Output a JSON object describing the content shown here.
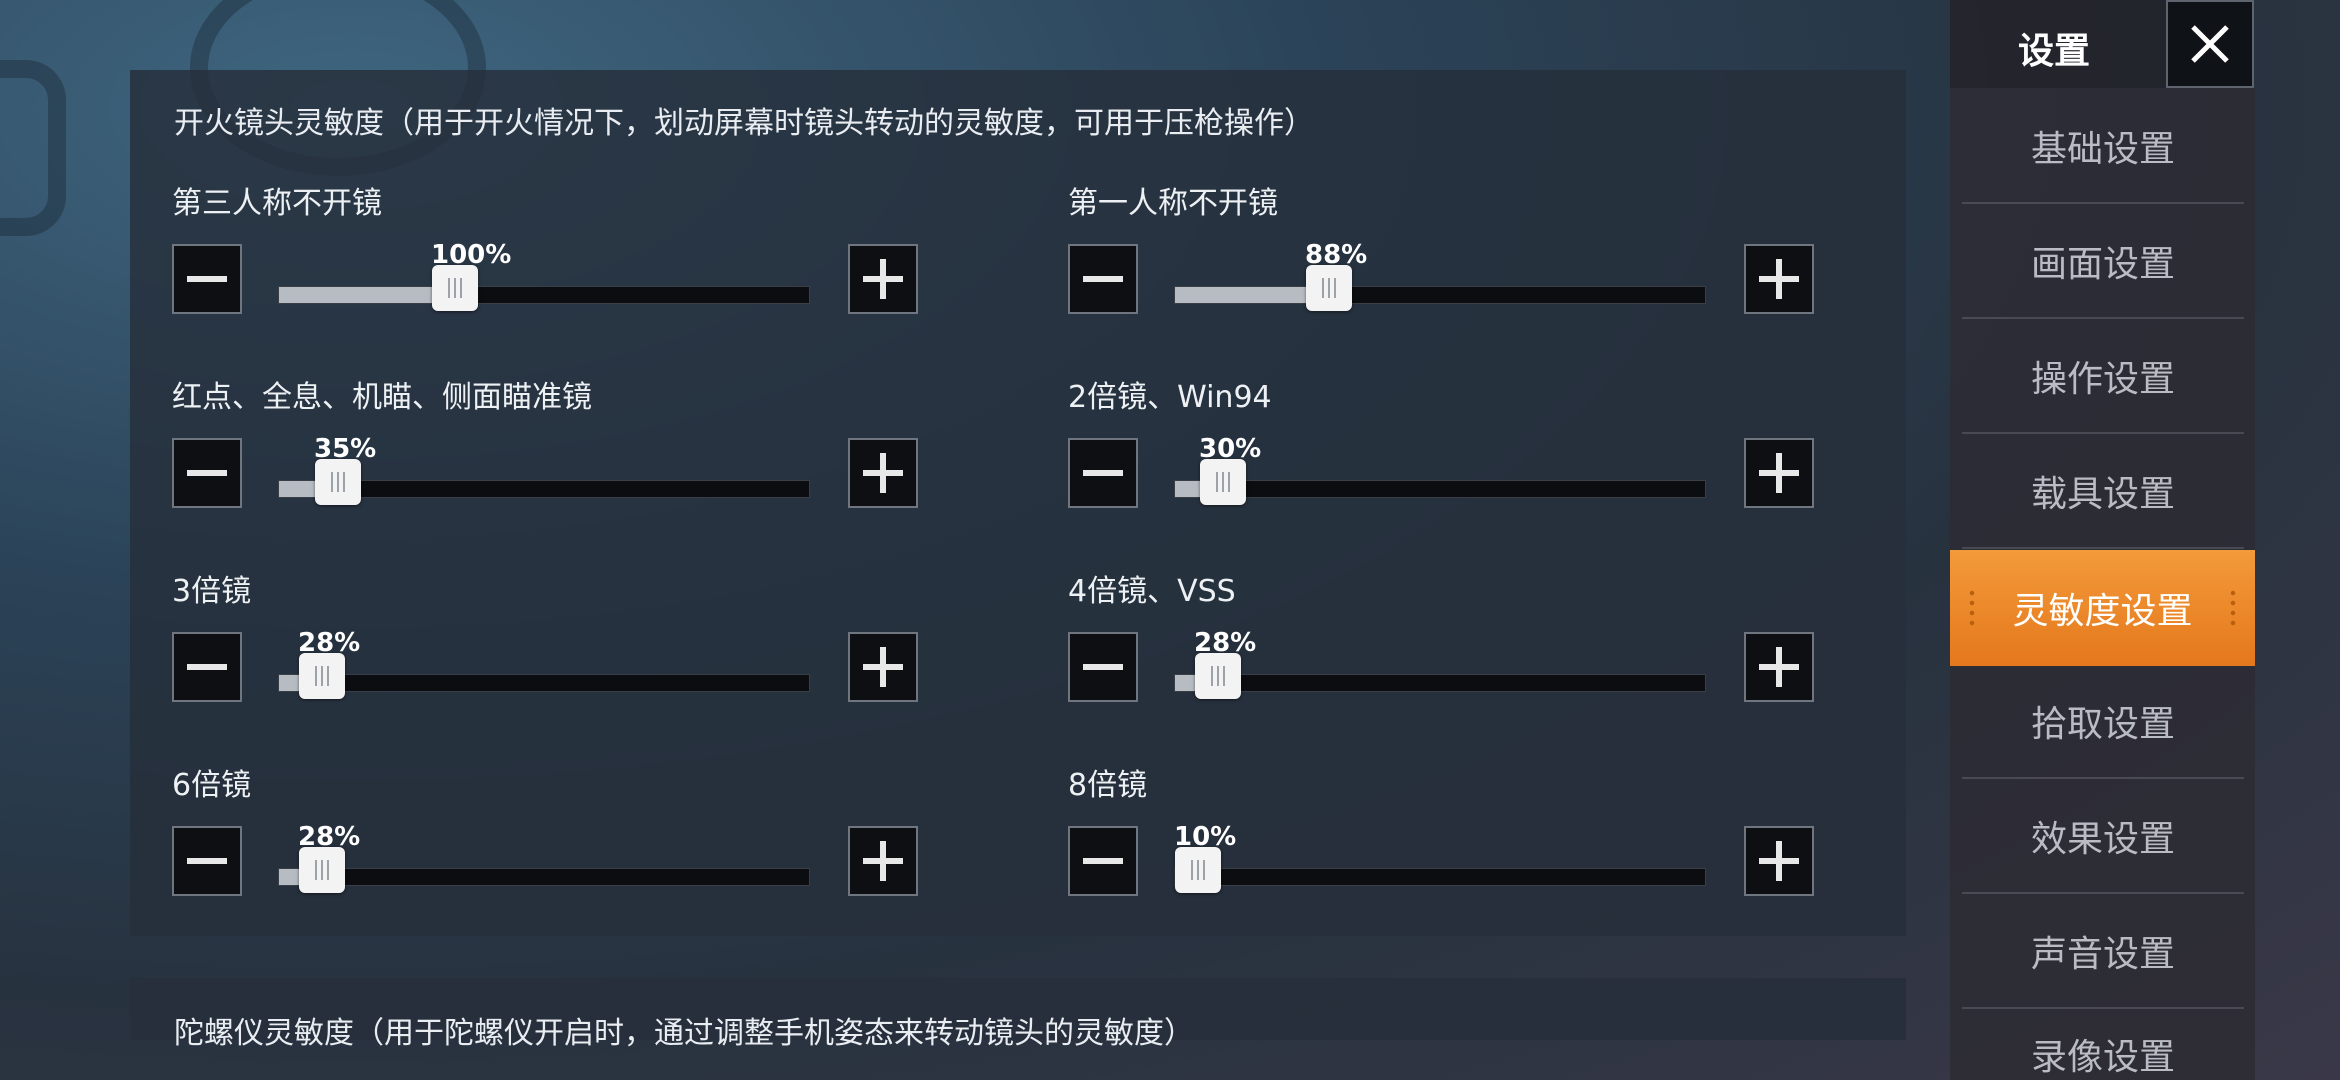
{
  "fire_scope_panel": {
    "title": "开火镜头灵敏度（用于开火情况下，划动屏幕时镜头转动的灵敏度，可用于压枪操作）",
    "sliders": [
      {
        "label": "第三人称不开镜",
        "value_label": "100%",
        "fraction": 0.33
      },
      {
        "label": "第一人称不开镜",
        "value_label": "88%",
        "fraction": 0.29
      },
      {
        "label": "红点、全息、机瞄、侧面瞄准镜",
        "value_label": "35%",
        "fraction": 0.11
      },
      {
        "label": "2倍镜、Win94",
        "value_label": "30%",
        "fraction": 0.09
      },
      {
        "label": "3倍镜",
        "value_label": "28%",
        "fraction": 0.08
      },
      {
        "label": "4倍镜、VSS",
        "value_label": "28%",
        "fraction": 0.08
      },
      {
        "label": "6倍镜",
        "value_label": "28%",
        "fraction": 0.08
      },
      {
        "label": "8倍镜",
        "value_label": "10%",
        "fraction": 0.03
      }
    ]
  },
  "gyro_panel": {
    "title": "陀螺仪灵敏度（用于陀螺仪开启时，通过调整手机姿态来转动镜头的灵敏度）"
  },
  "sidebar": {
    "title": "设置",
    "items": [
      {
        "label": "基础设置"
      },
      {
        "label": "画面设置"
      },
      {
        "label": "操作设置"
      },
      {
        "label": "载具设置"
      },
      {
        "label": "灵敏度设置"
      },
      {
        "label": "拾取设置"
      },
      {
        "label": "效果设置"
      },
      {
        "label": "声音设置"
      },
      {
        "label": "录像设置"
      }
    ],
    "active_index": 4
  },
  "colors": {
    "accent": "#e8821f",
    "panel": "#262e3a"
  },
  "icons": {
    "minus": "minus-icon",
    "plus": "plus-icon",
    "close": "close-icon"
  }
}
